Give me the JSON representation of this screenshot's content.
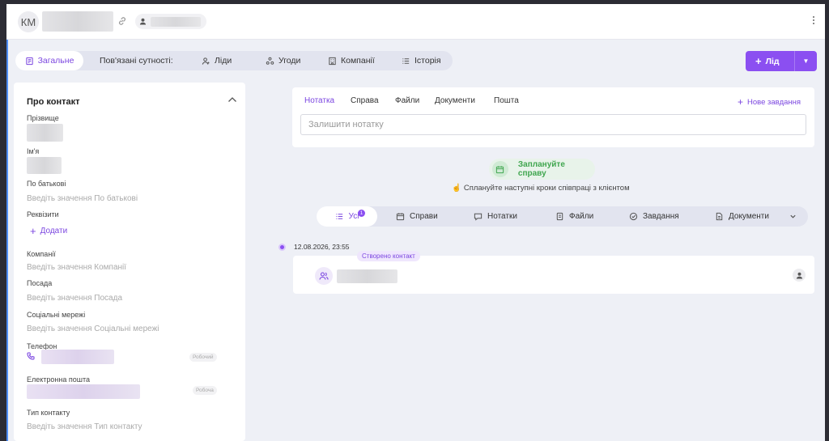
{
  "header": {
    "avatar_initials": "КМ",
    "icons": [
      "link-icon",
      "user-icon",
      "kebab-menu-icon"
    ]
  },
  "tabs": {
    "general": "Загальне",
    "related_label": "Пов'язані сутності:",
    "leads": "Ліди",
    "deals": "Угоди",
    "companies": "Компанії",
    "history": "Історія"
  },
  "lead_button": {
    "label": "Лід",
    "plus": "+"
  },
  "contact_panel": {
    "title": "Про контакт",
    "fields": {
      "surname_label": "Прізвище",
      "name_label": "Ім'я",
      "patronymic_label": "По батькові",
      "patronymic_placeholder": "Введіть значення По батькові",
      "requisites_label": "Реквізити",
      "add_label": "Додати",
      "companies_label": "Компанії",
      "companies_placeholder": "Введіть значення Компанії",
      "position_label": "Посада",
      "position_placeholder": "Введіть значення Посада",
      "social_label": "Соціальні мережі",
      "social_placeholder": "Введіть значення Соціальні мережі",
      "phone_label": "Телефон",
      "phone_tag": "Робочий",
      "email_label": "Електронна пошта",
      "email_tag": "Робоча",
      "contact_type_label": "Тип контакту",
      "contact_type_placeholder": "Введіть значення Тип контакту"
    }
  },
  "note_card": {
    "tabs": [
      "Нотатка",
      "Справа",
      "Файли",
      "Документи",
      "Пошта"
    ],
    "new_task": "Нове завдання",
    "input_placeholder": "Залишити нотатку"
  },
  "plan": {
    "button": "Заплануйте справу",
    "hint": "Сплануйте наступні кроки співпраці з клієнтом",
    "hint_emoji": "☝"
  },
  "filters": {
    "all": "Усі",
    "all_count": "1",
    "tasks": "Справи",
    "notes": "Нотатки",
    "files": "Файли",
    "assignments": "Завдання",
    "documents": "Документи"
  },
  "timeline": {
    "date": "12.08.2026, 23:55",
    "event_tag": "Створено контакт"
  },
  "colors": {
    "accent": "#8b4ff1",
    "accent_text": "#7b46e0",
    "success": "#40a64f",
    "background": "#eef0f6"
  }
}
